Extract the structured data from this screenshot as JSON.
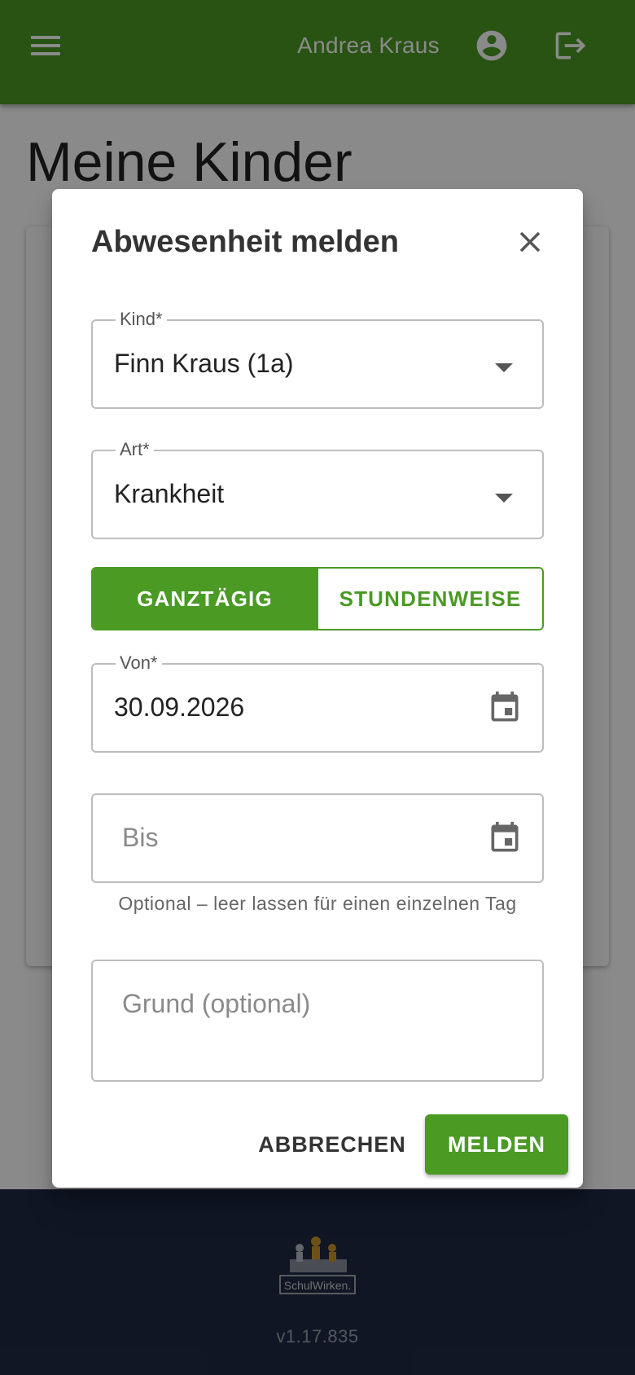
{
  "header": {
    "user_name": "Andrea Kraus",
    "menu_icon": "hamburger-menu-icon",
    "account_icon": "account-circle-icon",
    "logout_icon": "logout-icon",
    "bar_color": "#4a9a24"
  },
  "page": {
    "title": "Meine Kinder"
  },
  "dialog": {
    "title": "Abwesenheit melden",
    "close_icon": "close-icon",
    "child_field": {
      "label": "Kind*",
      "value": "Finn Kraus (1a)"
    },
    "type_field": {
      "label": "Art*",
      "value": "Krankheit"
    },
    "duration_toggle": {
      "options": [
        "GANZTÄGIG",
        "STUNDENWEISE"
      ],
      "selected": "GANZTÄGIG"
    },
    "from_field": {
      "label": "Von*",
      "value": "30.09.2026",
      "icon": "calendar-icon"
    },
    "to_field": {
      "placeholder": "Bis",
      "icon": "calendar-icon",
      "hint": "Optional – leer lassen für einen einzelnen Tag"
    },
    "reason_field": {
      "placeholder": "Grund (optional)"
    },
    "actions": {
      "cancel": "ABBRECHEN",
      "submit": "MELDEN"
    }
  },
  "footer": {
    "logo_text": "SchulWirken.",
    "version": "v1.17.835"
  },
  "colors": {
    "accent": "#4a9a24",
    "footer_bg": "#1f2a44"
  }
}
